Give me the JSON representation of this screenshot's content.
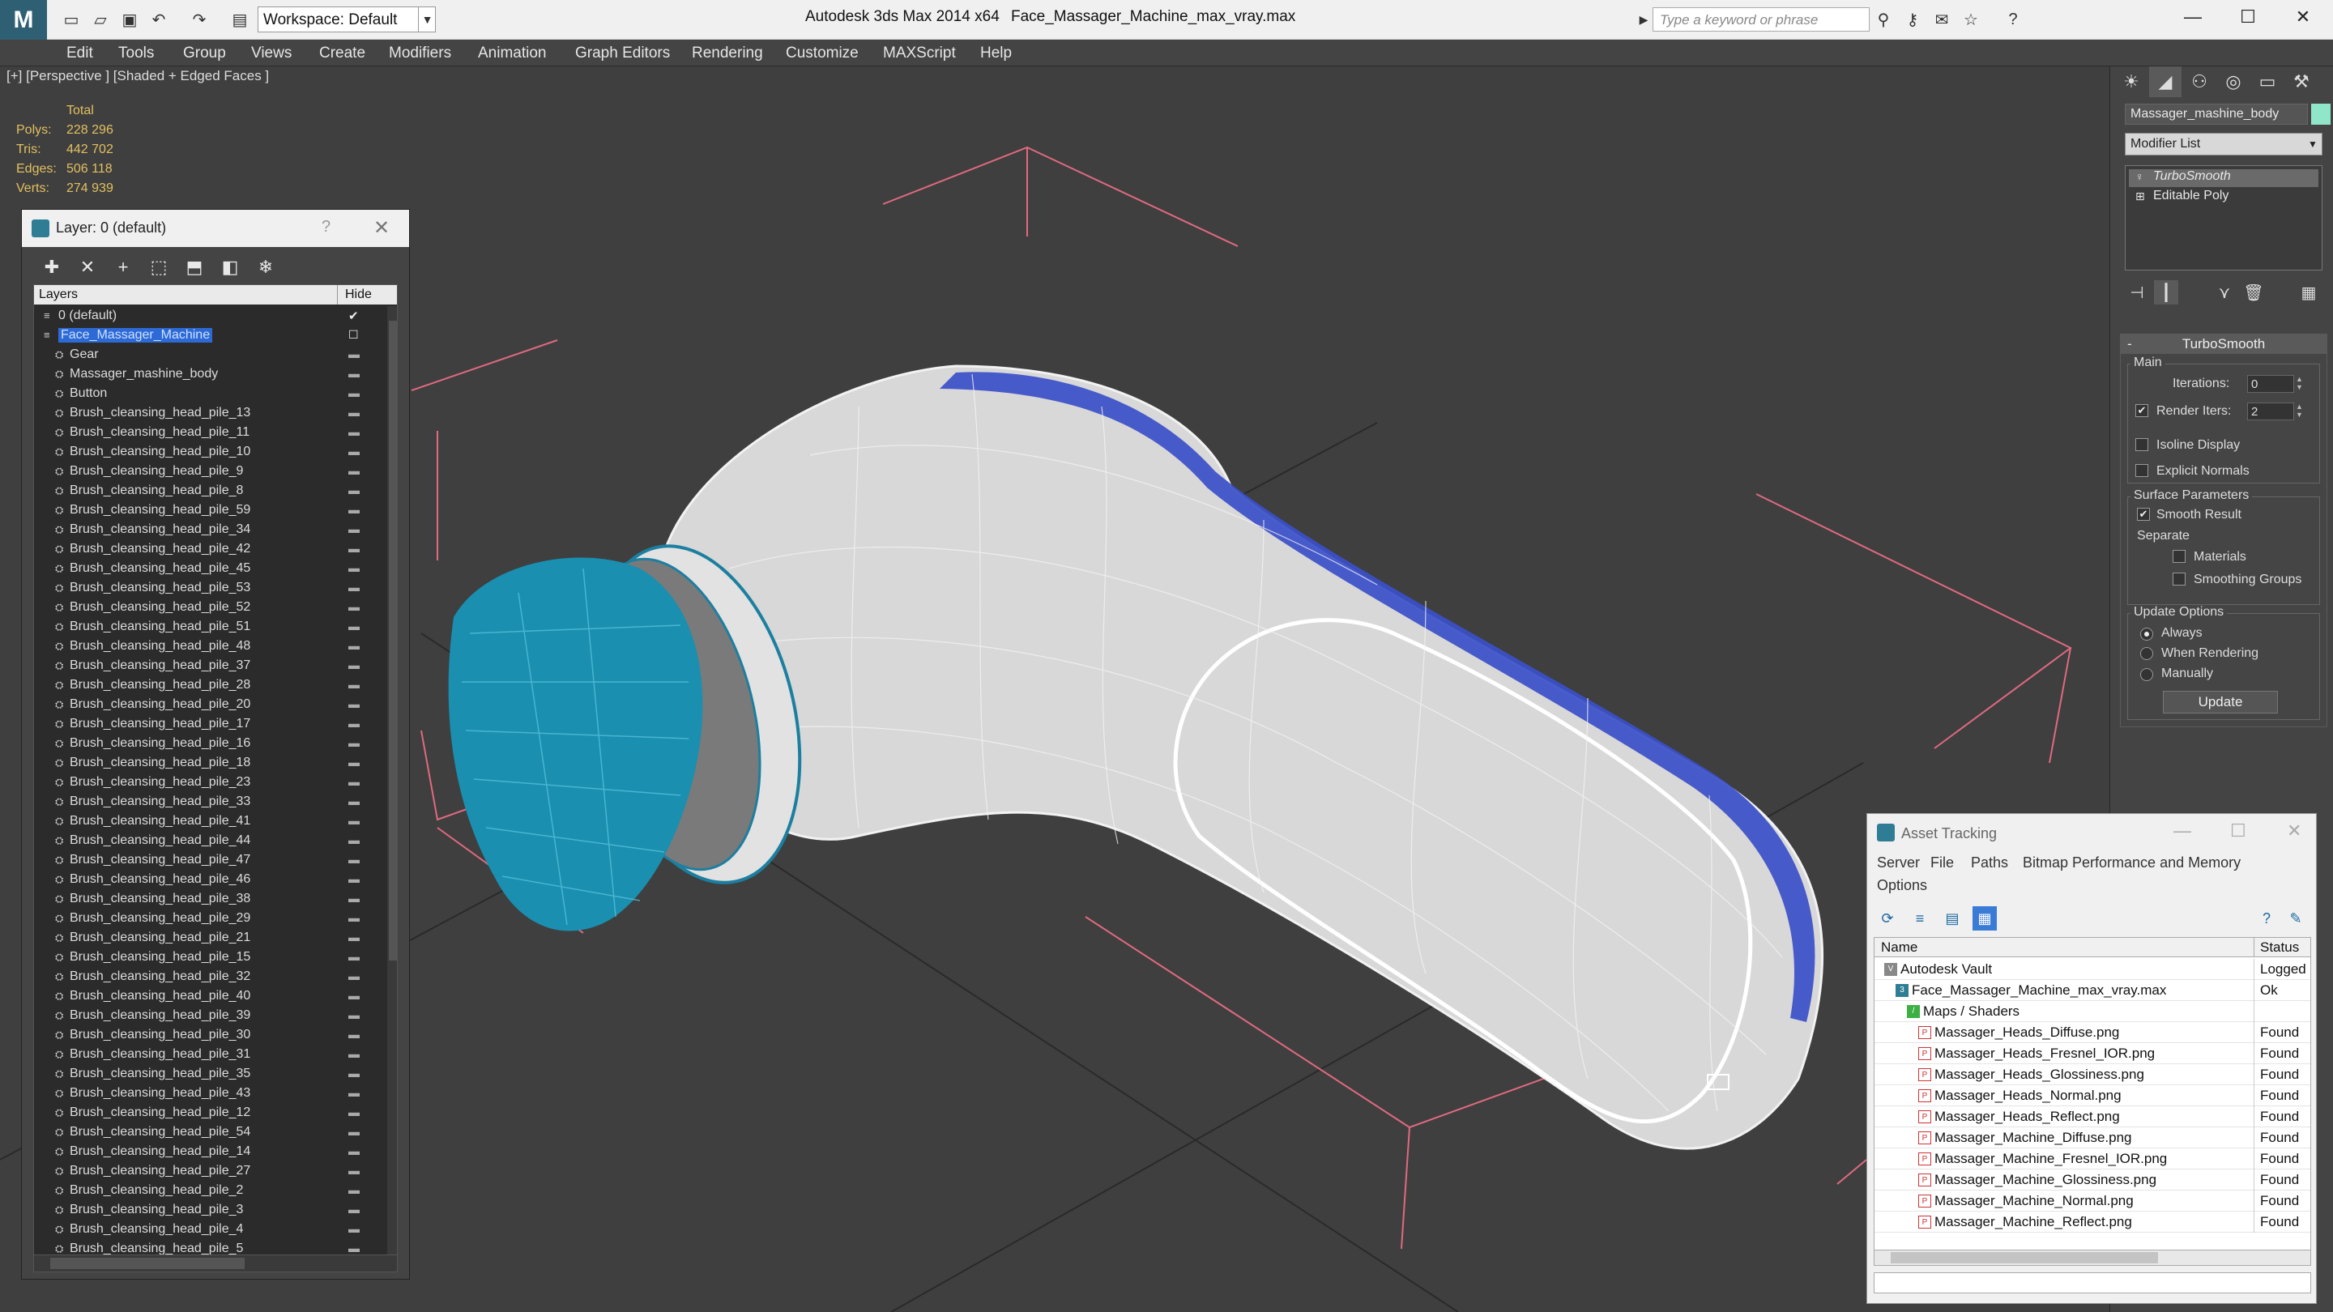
{
  "titlebar": {
    "workspace": "Workspace: Default",
    "app_title": "Autodesk 3ds Max  2014 x64",
    "file_title": "Face_Massager_Machine_max_vray.max",
    "search_placeholder": "Type a keyword or phrase"
  },
  "menubar": {
    "items": [
      "Edit",
      "Tools",
      "Group",
      "Views",
      "Create",
      "Modifiers",
      "Animation",
      "Graph Editors",
      "Rendering",
      "Customize",
      "MAXScript",
      "Help"
    ]
  },
  "viewport": {
    "label": "[+] [Perspective ] [Shaded + Edged Faces ]",
    "stats": {
      "header": "Total",
      "rows": [
        {
          "k": "Polys:",
          "v": "228 296"
        },
        {
          "k": "Tris:",
          "v": "442 702"
        },
        {
          "k": "Edges:",
          "v": "506 118"
        },
        {
          "k": "Verts:",
          "v": "274 939"
        }
      ]
    }
  },
  "layer_dialog": {
    "title": "Layer: 0 (default)",
    "help": "?",
    "col_layers": "Layers",
    "col_hide": "Hide",
    "rows": [
      {
        "name": "0 (default)",
        "level": 1,
        "check": "✔"
      },
      {
        "name": "Face_Massager_Machine",
        "level": 1,
        "selected": true
      },
      {
        "name": "Gear",
        "level": 2
      },
      {
        "name": "Massager_mashine_body",
        "level": 2
      },
      {
        "name": "Button",
        "level": 2
      },
      {
        "name": "Brush_cleansing_head_pile_13",
        "level": 2
      },
      {
        "name": "Brush_cleansing_head_pile_11",
        "level": 2
      },
      {
        "name": "Brush_cleansing_head_pile_10",
        "level": 2
      },
      {
        "name": "Brush_cleansing_head_pile_9",
        "level": 2
      },
      {
        "name": "Brush_cleansing_head_pile_8",
        "level": 2
      },
      {
        "name": "Brush_cleansing_head_pile_59",
        "level": 2
      },
      {
        "name": "Brush_cleansing_head_pile_34",
        "level": 2
      },
      {
        "name": "Brush_cleansing_head_pile_42",
        "level": 2
      },
      {
        "name": "Brush_cleansing_head_pile_45",
        "level": 2
      },
      {
        "name": "Brush_cleansing_head_pile_53",
        "level": 2
      },
      {
        "name": "Brush_cleansing_head_pile_52",
        "level": 2
      },
      {
        "name": "Brush_cleansing_head_pile_51",
        "level": 2
      },
      {
        "name": "Brush_cleansing_head_pile_48",
        "level": 2
      },
      {
        "name": "Brush_cleansing_head_pile_37",
        "level": 2
      },
      {
        "name": "Brush_cleansing_head_pile_28",
        "level": 2
      },
      {
        "name": "Brush_cleansing_head_pile_20",
        "level": 2
      },
      {
        "name": "Brush_cleansing_head_pile_17",
        "level": 2
      },
      {
        "name": "Brush_cleansing_head_pile_16",
        "level": 2
      },
      {
        "name": "Brush_cleansing_head_pile_18",
        "level": 2
      },
      {
        "name": "Brush_cleansing_head_pile_23",
        "level": 2
      },
      {
        "name": "Brush_cleansing_head_pile_33",
        "level": 2
      },
      {
        "name": "Brush_cleansing_head_pile_41",
        "level": 2
      },
      {
        "name": "Brush_cleansing_head_pile_44",
        "level": 2
      },
      {
        "name": "Brush_cleansing_head_pile_47",
        "level": 2
      },
      {
        "name": "Brush_cleansing_head_pile_46",
        "level": 2
      },
      {
        "name": "Brush_cleansing_head_pile_38",
        "level": 2
      },
      {
        "name": "Brush_cleansing_head_pile_29",
        "level": 2
      },
      {
        "name": "Brush_cleansing_head_pile_21",
        "level": 2
      },
      {
        "name": "Brush_cleansing_head_pile_15",
        "level": 2
      },
      {
        "name": "Brush_cleansing_head_pile_32",
        "level": 2
      },
      {
        "name": "Brush_cleansing_head_pile_40",
        "level": 2
      },
      {
        "name": "Brush_cleansing_head_pile_39",
        "level": 2
      },
      {
        "name": "Brush_cleansing_head_pile_30",
        "level": 2
      },
      {
        "name": "Brush_cleansing_head_pile_31",
        "level": 2
      },
      {
        "name": "Brush_cleansing_head_pile_35",
        "level": 2
      },
      {
        "name": "Brush_cleansing_head_pile_43",
        "level": 2
      },
      {
        "name": "Brush_cleansing_head_pile_12",
        "level": 2
      },
      {
        "name": "Brush_cleansing_head_pile_54",
        "level": 2
      },
      {
        "name": "Brush_cleansing_head_pile_14",
        "level": 2
      },
      {
        "name": "Brush_cleansing_head_pile_27",
        "level": 2
      },
      {
        "name": "Brush_cleansing_head_pile_2",
        "level": 2
      },
      {
        "name": "Brush_cleansing_head_pile_3",
        "level": 2
      },
      {
        "name": "Brush_cleansing_head_pile_4",
        "level": 2
      },
      {
        "name": "Brush_cleansing_head_pile_5",
        "level": 2
      }
    ]
  },
  "command_panel": {
    "object_name": "Massager_mashine_body",
    "object_color": "#8fe6c8",
    "modifier_list": "Modifier List",
    "stack": [
      "TurboSmooth",
      "Editable Poly"
    ],
    "rollout": {
      "title": "TurboSmooth",
      "main_label": "Main",
      "iterations_label": "Iterations:",
      "iterations_value": "0",
      "render_iters_label": "Render Iters:",
      "render_iters_value": "2",
      "isoline": "Isoline Display",
      "explicit": "Explicit Normals",
      "surface_label": "Surface Parameters",
      "smooth_result": "Smooth Result",
      "separate": "Separate",
      "materials": "Materials",
      "smoothing_groups": "Smoothing Groups",
      "update_options": "Update Options",
      "always": "Always",
      "when_rendering": "When Rendering",
      "manually": "Manually",
      "update_button": "Update"
    }
  },
  "asset_tracking": {
    "title": "Asset Tracking",
    "menu": [
      "Server",
      "File",
      "Paths",
      "Bitmap Performance and Memory",
      "Options"
    ],
    "col_name": "Name",
    "col_status": "Status",
    "rows": [
      {
        "name": "Autodesk Vault",
        "status": "Logged O",
        "indent": 0,
        "icon": "vault"
      },
      {
        "name": "Face_Massager_Machine_max_vray.max",
        "status": "Ok",
        "indent": 1,
        "icon": "max"
      },
      {
        "name": "Maps / Shaders",
        "status": "",
        "indent": 2,
        "icon": "maps"
      },
      {
        "name": "Massager_Heads_Diffuse.png",
        "status": "Found",
        "indent": 3,
        "icon": "png"
      },
      {
        "name": "Massager_Heads_Fresnel_IOR.png",
        "status": "Found",
        "indent": 3,
        "icon": "png"
      },
      {
        "name": "Massager_Heads_Glossiness.png",
        "status": "Found",
        "indent": 3,
        "icon": "png"
      },
      {
        "name": "Massager_Heads_Normal.png",
        "status": "Found",
        "indent": 3,
        "icon": "png"
      },
      {
        "name": "Massager_Heads_Reflect.png",
        "status": "Found",
        "indent": 3,
        "icon": "png"
      },
      {
        "name": "Massager_Machine_Diffuse.png",
        "status": "Found",
        "indent": 3,
        "icon": "png"
      },
      {
        "name": "Massager_Machine_Fresnel_IOR.png",
        "status": "Found",
        "indent": 3,
        "icon": "png"
      },
      {
        "name": "Massager_Machine_Glossiness.png",
        "status": "Found",
        "indent": 3,
        "icon": "png"
      },
      {
        "name": "Massager_Machine_Normal.png",
        "status": "Found",
        "indent": 3,
        "icon": "png"
      },
      {
        "name": "Massager_Machine_Reflect.png",
        "status": "Found",
        "indent": 3,
        "icon": "png"
      }
    ]
  },
  "colors": {
    "viewport_bg": "#3f3f3f",
    "selection": "#2d6ad6",
    "stats": "#e2c060",
    "model_stripe": "#3b4fc8",
    "brush": "#1a8fb0",
    "gizmo": "#e06a80"
  }
}
